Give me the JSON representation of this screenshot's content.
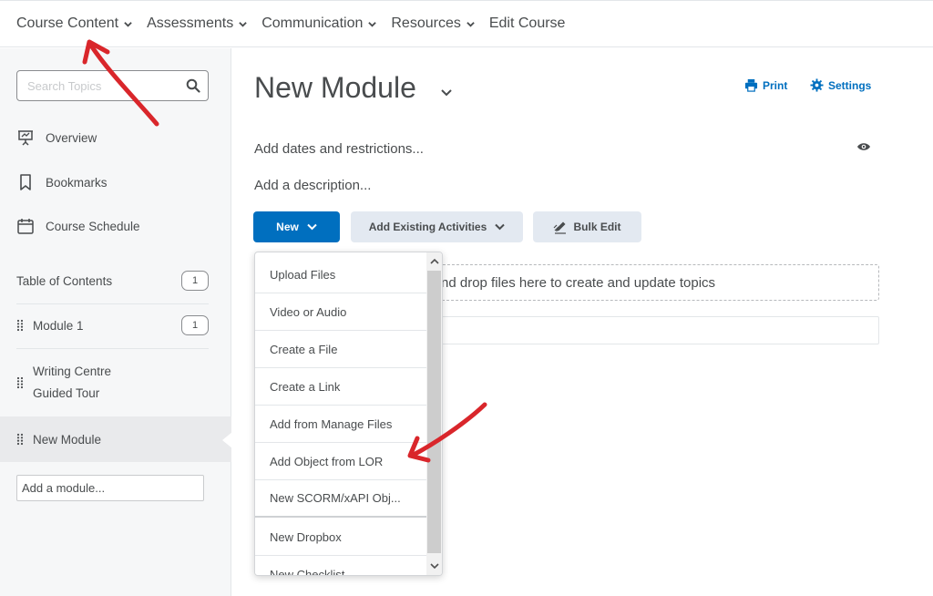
{
  "topnav": {
    "items": [
      {
        "label": "Course Content",
        "has_menu": true
      },
      {
        "label": "Assessments",
        "has_menu": true
      },
      {
        "label": "Communication",
        "has_menu": true
      },
      {
        "label": "Resources",
        "has_menu": true
      },
      {
        "label": "Edit Course",
        "has_menu": false
      }
    ]
  },
  "sidebar": {
    "search_placeholder": "Search Topics",
    "links": [
      {
        "label": "Overview",
        "icon": "presentation-icon"
      },
      {
        "label": "Bookmarks",
        "icon": "bookmark-icon"
      },
      {
        "label": "Course Schedule",
        "icon": "calendar-icon"
      }
    ],
    "toc": {
      "label": "Table of Contents",
      "count": "1"
    },
    "modules": [
      {
        "label": "Module 1",
        "count": "1"
      },
      {
        "label_line1": "Writing Centre",
        "label_line2": "Guided Tour"
      },
      {
        "label": "New Module",
        "selected": true
      }
    ],
    "add_module_placeholder": "Add a module..."
  },
  "main": {
    "title": "New Module",
    "print_label": "Print",
    "settings_label": "Settings",
    "dates_link": "Add dates and restrictions...",
    "description_link": "Add a description...",
    "buttons": {
      "new": "New",
      "add_existing": "Add Existing Activities",
      "bulk_edit": "Bulk Edit"
    },
    "dropzone_text": "nd drop files here to create and update topics"
  },
  "new_menu": {
    "items": [
      "Upload Files",
      "Video or Audio",
      "Create a File",
      "Create a Link",
      "Add from Manage Files",
      "Add Object from LOR",
      "New SCORM/xAPI Obj...",
      "New Dropbox",
      "New Checklist"
    ]
  },
  "colors": {
    "primary": "#006fbf",
    "annotation_arrow": "#d9262b",
    "sidebar_bg": "#f6f7f8"
  }
}
